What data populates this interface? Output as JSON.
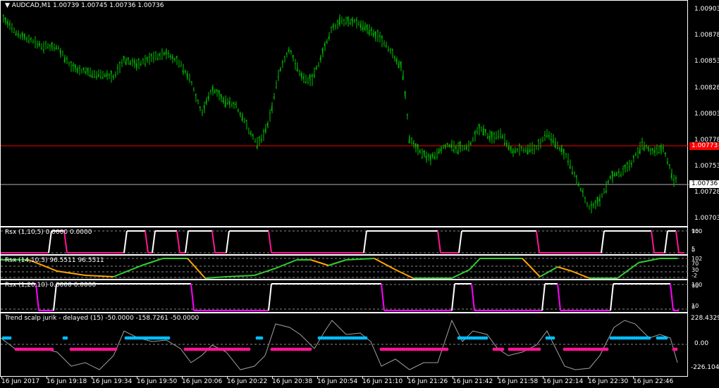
{
  "main": {
    "title": "AUDCAD,M1  1.00739 1.00745 1.00736 1.00736",
    "price_labels": [
      "1.00903",
      "1.00878",
      "1.00853",
      "1.00828",
      "1.00803",
      "1.00778",
      "1.00753",
      "1.00728",
      "1.00703"
    ],
    "bid_tag": "1.00773",
    "ask_tag": "1.00736",
    "colors": {
      "bars": "#00c000",
      "bid_line": "#ff0000",
      "ask_line": "#b0b0b0"
    }
  },
  "rsx1": {
    "title": "Rsx (1,10,5) 0.0000 0.0000",
    "scale_labels": [
      "100",
      "95",
      "5",
      "0"
    ],
    "colors": {
      "up": "#ffffff",
      "down": "#ff1493"
    }
  },
  "rsx2": {
    "title": "Rsx (14,10,5) 96.5511 96.5511",
    "scale_labels": [
      "102",
      "70",
      "30",
      "-2"
    ],
    "colors": {
      "up": "#32cd32",
      "down": "#ffa500"
    }
  },
  "rsx3": {
    "title": "Rsx (1,20,10) 0.0000 0.0000",
    "scale_labels": [
      "100",
      "90",
      "10",
      "0"
    ],
    "colors": {
      "up": "#ffffff",
      "down": "#ff00ff"
    }
  },
  "jurik": {
    "title": "Trend scalp jurik - delayed (15) -50.0000 -158.7261 -50.0000",
    "scale_labels": [
      "228.4329",
      "0.00",
      "-226.1047"
    ],
    "colors": {
      "line": "#a0a0a0",
      "up": "#00bfff",
      "down": "#ff1493"
    }
  },
  "time_axis": [
    "16 Jun 2017",
    "16 Jun 19:18",
    "16 Jun 19:34",
    "16 Jun 19:50",
    "16 Jun 20:06",
    "16 Jun 20:22",
    "16 Jun 20:38",
    "16 Jun 20:54",
    "16 Jun 21:10",
    "16 Jun 21:26",
    "16 Jun 21:42",
    "16 Jun 21:58",
    "16 Jun 22:14",
    "16 Jun 22:30",
    "16 Jun 22:46"
  ]
}
